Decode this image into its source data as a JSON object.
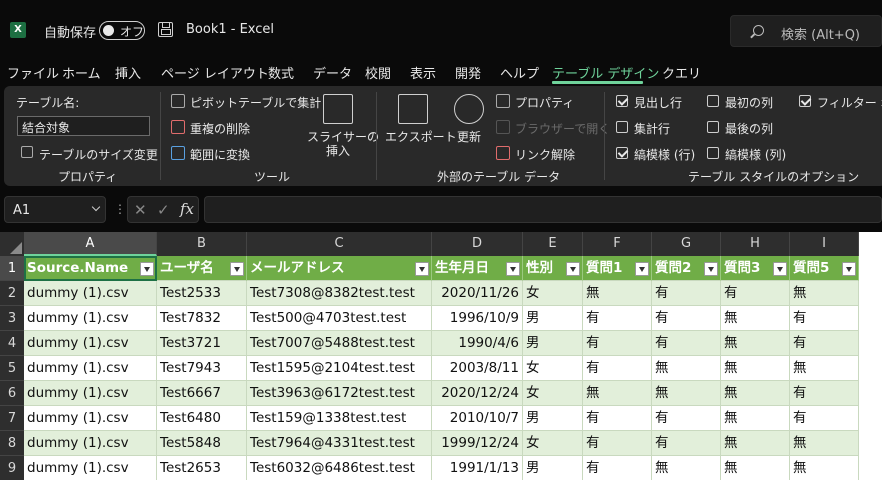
{
  "titlebar": {
    "app_icon": "excel-icon",
    "app_icon_letter": "X",
    "autosave_label": "自動保存",
    "autosave_state": "オフ",
    "doc_title": "Book1  -  Excel",
    "search_placeholder": "検索 (Alt+Q)"
  },
  "tabs": [
    "ファイル",
    "ホーム",
    "挿入",
    "ページ レイアウト",
    "数式",
    "データ",
    "校閲",
    "表示",
    "開発",
    "ヘルプ",
    "テーブル デザイン",
    "クエリ"
  ],
  "active_tab": "テーブル デザイン",
  "ribbon": {
    "properties": {
      "table_name_label": "テーブル名:",
      "table_name_value": "結合対象",
      "resize_label": "テーブルのサイズ変更",
      "group_label": "プロパティ"
    },
    "tools": {
      "pivot_label": "ピボットテーブルで集計",
      "remove_dup_label": "重複の削除",
      "convert_label": "範囲に変換",
      "slicer_label_1": "スライサーの",
      "slicer_label_2": "挿入",
      "group_label": "ツール"
    },
    "external": {
      "export_label": "エクスポート",
      "refresh_label": "更新",
      "properties_label": "プロパティ",
      "browser_label": "ブラウザーで開く",
      "unlink_label": "リンク解除",
      "group_label": "外部のテーブル データ"
    },
    "style_options": {
      "header_row": {
        "label": "見出し行",
        "checked": true
      },
      "total_row": {
        "label": "集計行",
        "checked": false
      },
      "banded_rows": {
        "label": "縞模様 (行)",
        "checked": true
      },
      "first_col": {
        "label": "最初の列",
        "checked": false
      },
      "last_col": {
        "label": "最後の列",
        "checked": false
      },
      "banded_cols": {
        "label": "縞模様 (列)",
        "checked": false
      },
      "filter_button": {
        "label": "フィルター ボタ",
        "checked": true
      },
      "group_label": "テーブル スタイルのオプション"
    }
  },
  "formula_bar": {
    "name_box": "A1",
    "fx_label": "fx",
    "cancel_glyph": "✕",
    "enter_glyph": "✓",
    "formula": ""
  },
  "sheet": {
    "columns": [
      "A",
      "B",
      "C",
      "D",
      "E",
      "F",
      "G",
      "H",
      "I"
    ],
    "selected_column": "A",
    "row_numbers": [
      "1",
      "2",
      "3",
      "4",
      "5",
      "6",
      "7",
      "8",
      "9"
    ],
    "headers": [
      "Source.Name",
      "ユーザ名",
      "メールアドレス",
      "生年月日",
      "性別",
      "質問1",
      "質問2",
      "質問3",
      "質問5"
    ],
    "rows": [
      [
        "dummy (1).csv",
        "Test2533",
        "Test7308@8382test.test",
        "2020/11/26",
        "女",
        "無",
        "有",
        "有",
        "無"
      ],
      [
        "dummy (1).csv",
        "Test7832",
        "Test500@4703test.test",
        "1996/10/9",
        "男",
        "有",
        "有",
        "無",
        "有"
      ],
      [
        "dummy (1).csv",
        "Test3721",
        "Test7007@5488test.test",
        "1990/4/6",
        "男",
        "有",
        "有",
        "無",
        "有"
      ],
      [
        "dummy (1).csv",
        "Test7943",
        "Test1595@2104test.test",
        "2003/8/11",
        "女",
        "有",
        "無",
        "無",
        "無"
      ],
      [
        "dummy (1).csv",
        "Test6667",
        "Test3963@6172test.test",
        "2020/12/24",
        "女",
        "無",
        "無",
        "無",
        "有"
      ],
      [
        "dummy (1).csv",
        "Test6480",
        "Test159@1338test.test",
        "2010/10/7",
        "男",
        "有",
        "有",
        "無",
        "有"
      ],
      [
        "dummy (1).csv",
        "Test5848",
        "Test7964@4331test.test",
        "1999/12/24",
        "女",
        "有",
        "有",
        "無",
        "無"
      ],
      [
        "dummy (1).csv",
        "Test2653",
        "Test6032@6486test.test",
        "1991/1/13",
        "男",
        "有",
        "無",
        "無",
        "無"
      ]
    ]
  },
  "colors": {
    "accent": "#6fd39b",
    "table_header": "#70ad47",
    "band": "#e2efda",
    "active_border": "#1e7145"
  }
}
